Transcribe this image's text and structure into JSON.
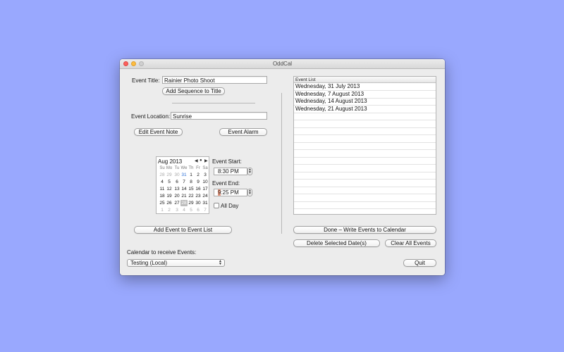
{
  "window": {
    "title": "OddCal"
  },
  "form": {
    "event_title_label": "Event Title:",
    "event_title_value": "Rainier Photo Shoot",
    "add_sequence_label": "Add Sequence to Title",
    "event_location_label": "Event Location:",
    "event_location_value": "Sunrise",
    "edit_note_label": "Edit Event Note",
    "event_alarm_label": "Event Alarm",
    "event_start_label": "Event Start:",
    "event_start_hour": "8",
    "event_start_rest": ":30 PM",
    "event_end_label": "Event End:",
    "event_end_hour": "9",
    "event_end_rest": ":25 PM",
    "all_day_label": "All Day",
    "add_event_label": "Add Event to Event List",
    "calendar_receive_label": "Calendar to receive Events:",
    "calendar_select_value": "Testing (Local)"
  },
  "calendar": {
    "month_label": "Aug 2013",
    "dow": [
      "Su",
      "Mo",
      "Tu",
      "We",
      "Th",
      "Fr",
      "Sa"
    ],
    "weeks": [
      [
        "28",
        "29",
        "30",
        "31",
        "1",
        "2",
        "3"
      ],
      [
        "4",
        "5",
        "6",
        "7",
        "8",
        "9",
        "10"
      ],
      [
        "11",
        "12",
        "13",
        "14",
        "15",
        "16",
        "17"
      ],
      [
        "18",
        "19",
        "20",
        "21",
        "22",
        "23",
        "24"
      ],
      [
        "25",
        "26",
        "27",
        "28",
        "29",
        "30",
        "31"
      ],
      [
        "1",
        "2",
        "3",
        "4",
        "5",
        "6",
        "7"
      ]
    ]
  },
  "event_list": {
    "header": "Event List",
    "rows": [
      "Wednesday, 31 July 2013",
      "Wednesday, 7 August 2013",
      "Wednesday, 14 August 2013",
      "Wednesday, 21 August 2013"
    ]
  },
  "actions": {
    "done_label": "Done – Write Events to Calendar",
    "delete_label": "Delete Selected Date(s)",
    "clear_label": "Clear All Events",
    "quit_label": "Quit"
  },
  "colors": {
    "desktop": "#99A8FE",
    "window": "#ececec",
    "today_accent": "#2a6fd6",
    "time_highlight": "#f3a48a"
  }
}
